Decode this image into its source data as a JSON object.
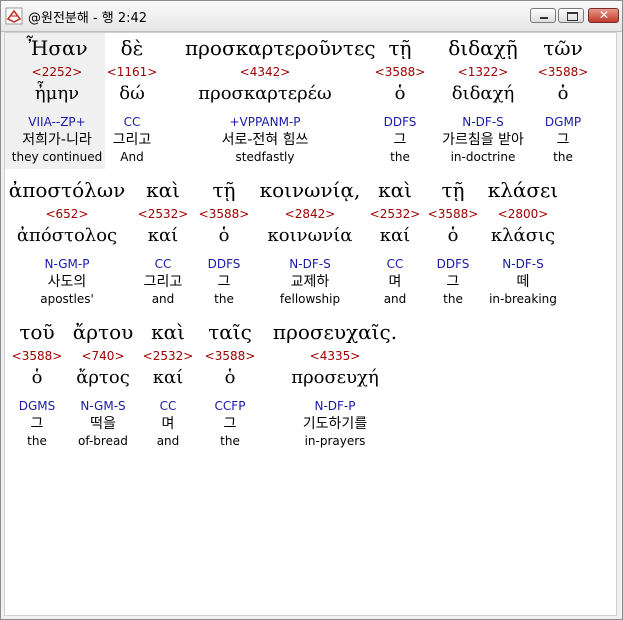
{
  "window": {
    "title": "@원전분해 - 행 2:42"
  },
  "text_words": [
    "Ἦσαν",
    "δὲ",
    "προσκαρτεροῦντες",
    "τῇ",
    "διδαχῇ",
    "τῶν",
    "ἀποστόλων",
    "καὶ",
    "τῇ",
    "κοινωνίᾳ,",
    "καὶ",
    "τῇ",
    "κλάσει",
    "τοῦ",
    "ἄρτου",
    "καὶ",
    "ταῖς",
    "προσευχαῖς."
  ],
  "entries": [
    {
      "num": "<2252>",
      "lex": "ἦμην",
      "parse": "VIIA--ZP+",
      "kor": "저희가-니라",
      "eng": "they continued"
    },
    {
      "num": "<1161>",
      "lex": "δώ",
      "parse": "CC",
      "kor": "그리고",
      "eng": "And"
    },
    {
      "num": "<4342>",
      "lex": "προσκαρτερέω",
      "parse": "+VPPANM-P",
      "kor": "서로-전혀 힘쓰",
      "eng": "stedfastly"
    },
    {
      "num": "<3588>",
      "lex": "ὁ",
      "parse": "DDFS",
      "kor": "그",
      "eng": "the"
    },
    {
      "num": "<1322>",
      "lex": "διδαχή",
      "parse": "N-DF-S",
      "kor": "가르침을 받아",
      "eng": "in-doctrine"
    },
    {
      "num": "<3588>",
      "lex": "ὁ",
      "parse": "DGMP",
      "kor": "그",
      "eng": "the"
    },
    {
      "num": "<652>",
      "lex": "ἀπόστολος",
      "parse": "N-GM-P",
      "kor": "사도의",
      "eng": "apostles'"
    },
    {
      "num": "<2532>",
      "lex": "καί",
      "parse": "CC",
      "kor": "그리고",
      "eng": "and"
    },
    {
      "num": "<3588>",
      "lex": "ὁ",
      "parse": "DDFS",
      "kor": "그",
      "eng": "the"
    },
    {
      "num": "<2842>",
      "lex": "κοινωνία",
      "parse": "N-DF-S",
      "kor": "교제하",
      "eng": "fellowship"
    },
    {
      "num": "<2532>",
      "lex": "καί",
      "parse": "CC",
      "kor": "며",
      "eng": "and"
    },
    {
      "num": "<3588>",
      "lex": "ὁ",
      "parse": "DDFS",
      "kor": "그",
      "eng": "the"
    },
    {
      "num": "<2800>",
      "lex": "κλάσις",
      "parse": "N-DF-S",
      "kor": "떼",
      "eng": "in-breaking"
    },
    {
      "num": "<3588>",
      "lex": "ὁ",
      "parse": "DGMS",
      "kor": "그",
      "eng": "the"
    },
    {
      "num": "<740>",
      "lex": "ἄρτος",
      "parse": "N-GM-S",
      "kor": "떡을",
      "eng": "of-bread"
    },
    {
      "num": "<2532>",
      "lex": "καί",
      "parse": "CC",
      "kor": "며",
      "eng": "and"
    },
    {
      "num": "<3588>",
      "lex": "ὁ",
      "parse": "CCFP",
      "kor": "그",
      "eng": "the"
    },
    {
      "num": "<4335>",
      "lex": "προσευχή",
      "parse": "N-DF-P",
      "kor": "기도하기를",
      "eng": "in-prayers"
    }
  ],
  "colors": {
    "strongs": "#a00000",
    "parsing": "#1a1aa8",
    "selection": "#f0f0f0"
  },
  "icons": {
    "app": "bible-app-icon",
    "minimize": "minimize-icon",
    "maximize": "maximize-icon",
    "close": "close-icon"
  }
}
